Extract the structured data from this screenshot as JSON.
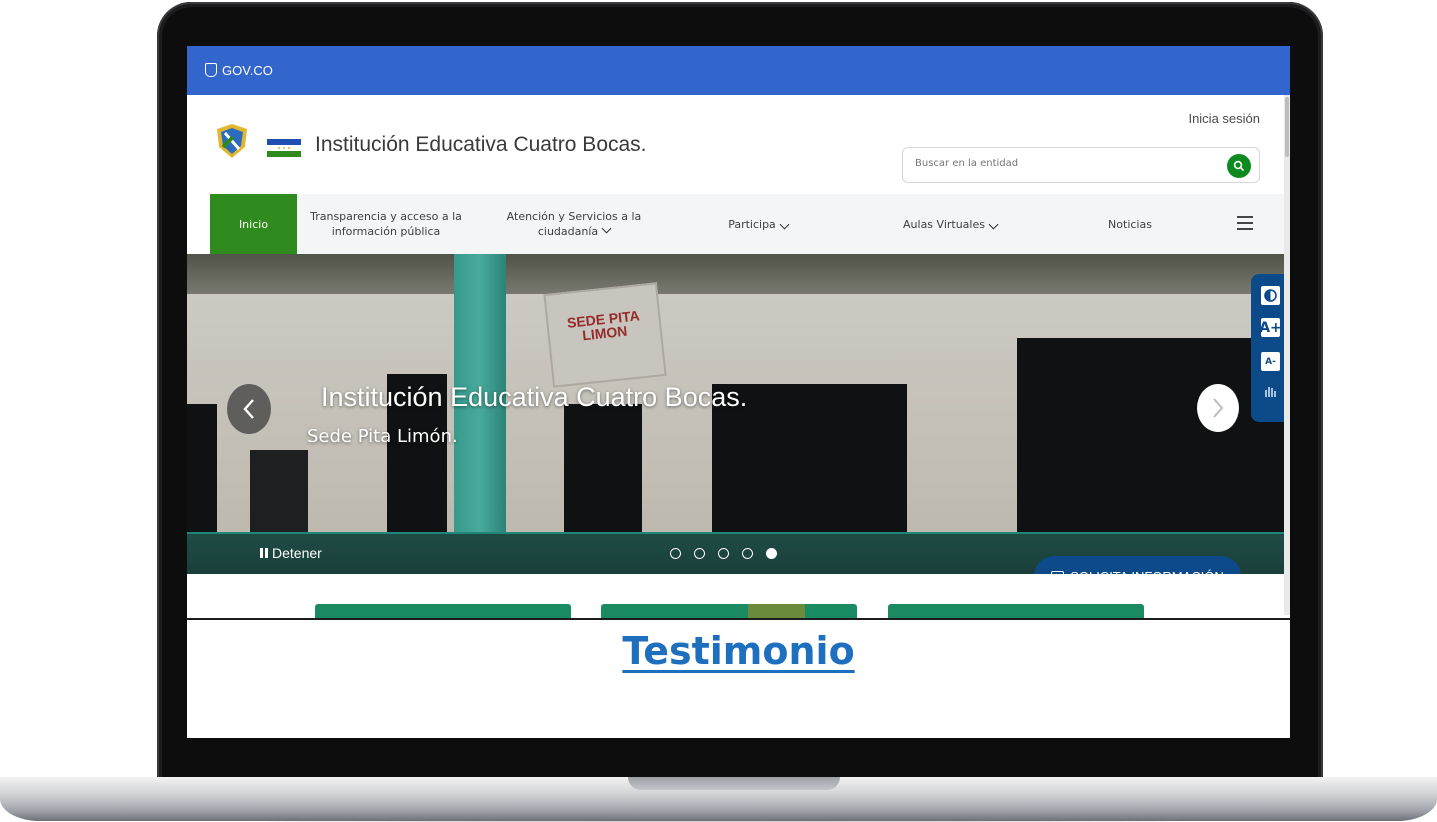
{
  "gov_bar": {
    "logo_text": "GOV.CO"
  },
  "header": {
    "site_title": "Institución Educativa Cuatro Bocas.",
    "login_label": "Inicia sesión",
    "search_placeholder": "Buscar en la entidad"
  },
  "nav": {
    "items": [
      {
        "label": "Inicio",
        "active": true
      },
      {
        "label": "Transparencia y acceso a la información pública"
      },
      {
        "label": "Atención y Servicios a la ciudadanía"
      },
      {
        "label": "Participa"
      },
      {
        "label": "Aulas Virtuales"
      },
      {
        "label": "Noticias"
      }
    ],
    "menu_icon": "hamburger-icon"
  },
  "carousel": {
    "title": "Institución Educativa Cuatro Bocas.",
    "subtitle": "Sede Pita Limón.",
    "sign_text": "SEDE PITA LIMON",
    "pause_label": "Detener",
    "slide_count": 5,
    "active_slide": 5
  },
  "accessibility": {
    "contrast_icon": "contrast-icon",
    "increase_label": "A+",
    "decrease_label": "A-",
    "sign_language_icon": "sign-language-icon"
  },
  "solicita": {
    "label": "SOLICITA INFORMACIÓN"
  },
  "section": {
    "heading": "Testimonio"
  },
  "colors": {
    "gov_blue": "#3366cc",
    "nav_active": "#2f8b1d",
    "accessibility_blue": "#0c4a8a",
    "heading_link": "#1f6fbf"
  }
}
